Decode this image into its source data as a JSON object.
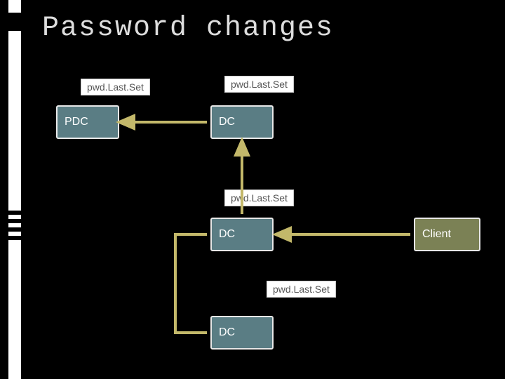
{
  "title": "Password changes",
  "nodes": {
    "pdc": "PDC",
    "dc1": "DC",
    "dc2": "DC",
    "dc3": "DC",
    "client": "Client"
  },
  "labels": {
    "pls1": "pwd.Last.Set",
    "pls2": "pwd.Last.Set",
    "pls3": "pwd.Last.Set",
    "pls4": "pwd.Last.Set"
  },
  "colors": {
    "node_blue": "#5a7d84",
    "node_olive": "#7b8155",
    "arrow": "#c3b86a",
    "bg": "#000000"
  }
}
